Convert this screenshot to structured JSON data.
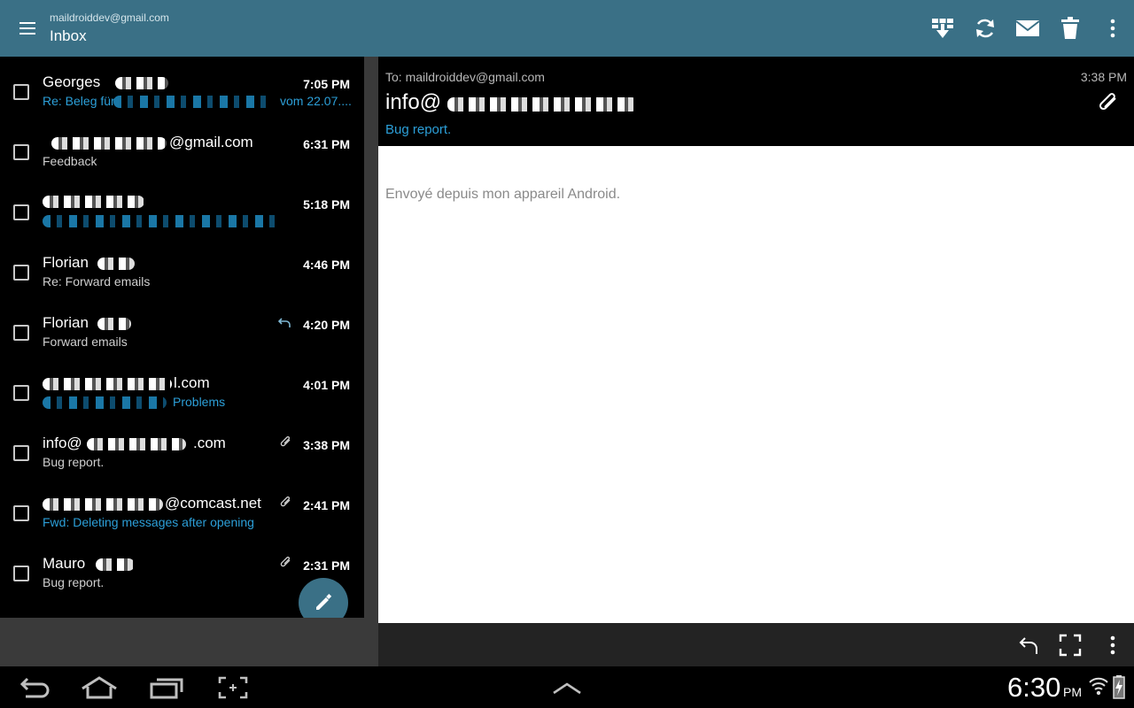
{
  "appbar": {
    "account": "maildroiddev@gmail.com",
    "folder": "Inbox",
    "actions": [
      "select-all-icon",
      "refresh-icon",
      "mark-read-icon",
      "delete-icon",
      "overflow-icon"
    ]
  },
  "messages": [
    {
      "sender": "Georges",
      "subject": "Re: Beleg für",
      "subject_tail": "vom 22.07....",
      "time": "7:05 PM",
      "subject_color": "blue",
      "icon": ""
    },
    {
      "sender": "@gmail.com",
      "subject": "Feedback",
      "time": "6:31 PM",
      "subject_color": "gray",
      "icon": ""
    },
    {
      "sender": "",
      "subject": "",
      "time": "5:18 PM",
      "subject_color": "blue",
      "icon": ""
    },
    {
      "sender": "Florian",
      "subject": "Re: Forward emails",
      "time": "4:46 PM",
      "subject_color": "gray",
      "icon": ""
    },
    {
      "sender": "Florian",
      "subject": "Forward emails",
      "time": "4:20 PM",
      "subject_color": "gray",
      "icon": "replied-icon"
    },
    {
      "sender": "l.com",
      "subject": "Problems",
      "time": "4:01 PM",
      "subject_color": "blue",
      "icon": ""
    },
    {
      "sender": "info@",
      "sender_tail": ".com",
      "subject": "Bug report.",
      "time": "3:38 PM",
      "subject_color": "gray",
      "icon": "attachment-icon"
    },
    {
      "sender": "@comcast.net",
      "subject": "Fwd: Deleting messages after opening",
      "time": "2:41 PM",
      "subject_color": "blue",
      "icon": "attachment-icon"
    },
    {
      "sender": "Mauro",
      "subject": "Bug report.",
      "time": "2:31 PM",
      "subject_color": "gray",
      "icon": "attachment-icon"
    }
  ],
  "reader": {
    "to": "To: maildroiddev@gmail.com",
    "time": "3:38 PM",
    "from": "info@",
    "subject": "Bug report.",
    "body": "Envoyé depuis mon appareil Android."
  },
  "system": {
    "clock": "6:30",
    "ampm": "PM"
  },
  "colors": {
    "accent": "#3a7086",
    "link_blue": "#2c9fd8"
  }
}
